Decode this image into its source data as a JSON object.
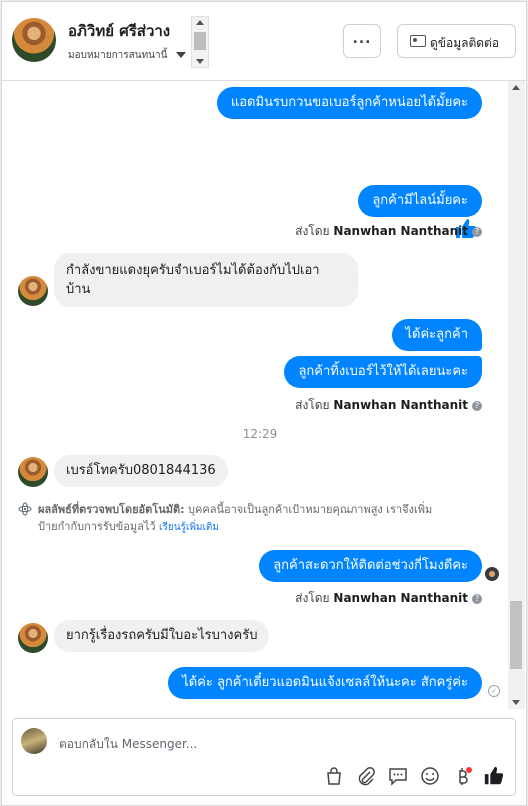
{
  "header": {
    "contact_name": "อภิวิทย์ ศรีส่วาง",
    "assign_label": "มอบหมายการสนทนานี้",
    "more_label": "...",
    "view_contact_label": "ดูข้อมูลติดต่อ"
  },
  "messages": {
    "m1": "แอดมินรบกวนขอเบอร์ลูกค้าหน่อยได้มั้ยคะ",
    "m2": "ลูกค้ามีไลน์มั้ยคะ",
    "sent_by_prefix": "ส่งโดย",
    "sender_name": "Nanwhan Nanthanit",
    "m3_line1": "กำลังขายแดงยุครับจำเบอร์ไมได้ต้องกับไปเอา",
    "m3_line2": "บ้าน",
    "m4": "ได้ค่ะลูกค้า",
    "m5": "ลูกค้าทิ้งเบอร์ไว้ให้ได้เลยนะคะ",
    "time": "12:29",
    "m6": "เบรอ์โทครับ0801844136",
    "ai_label": "ผลลัพธ์ที่ตรวจพบโดยอัตโนมัติ:",
    "ai_text1": "บุคคลนี้อาจเป็นลูกค้าเป้าหมายคุณภาพสูง เราจึงเพิ่ม",
    "ai_text2": "ป้ายกำกับการรับข้อมูลไว้",
    "ai_link": "เรียนรู้เพิ่มเติม",
    "m7": "ลูกค้าสะดวกให้ติดต่อช่วงกี่โมงดีคะ",
    "m8": "ยากรู้เรื่องรถครับมีใบอะไรบางครับ",
    "m9": "ได้ค่ะ ลูกค้าเดี๋ยวแอดมินแจ้งเซลล์ให้นะคะ สักครู่ค่ะ"
  },
  "composer": {
    "placeholder": "ตอบกลับใน Messenger..."
  },
  "colors": {
    "outgoing_bubble": "#0084ff",
    "incoming_bubble": "#f0f0f0",
    "like_blue": "#0084ff"
  }
}
